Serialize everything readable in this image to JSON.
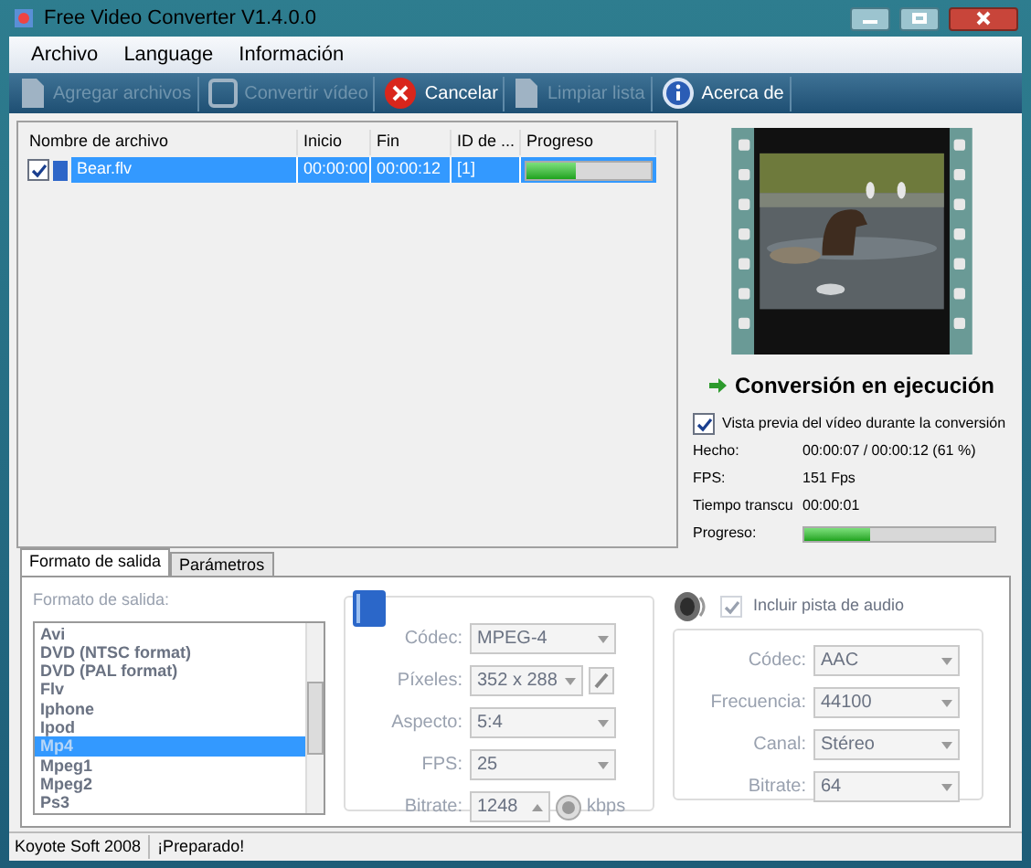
{
  "window": {
    "title": "Free Video Converter V1.4.0.0"
  },
  "menu": [
    "Archivo",
    "Language",
    "Información"
  ],
  "toolbar": [
    {
      "label": "Agregar archivos",
      "kind": "add",
      "disabled": true
    },
    {
      "label": "Convertir vídeo",
      "kind": "convert",
      "disabled": true
    },
    {
      "label": "Cancelar",
      "kind": "cancel",
      "disabled": false
    },
    {
      "label": "Limpiar lista",
      "kind": "clear",
      "disabled": true
    },
    {
      "label": "Acerca de",
      "kind": "about",
      "disabled": false
    }
  ],
  "file_table": {
    "columns": [
      "Nombre de archivo",
      "Inicio",
      "Fin",
      "ID de ...",
      "Progreso"
    ],
    "rows": [
      {
        "checked": true,
        "selected": true,
        "cells": [
          "Bear.flv",
          "00:00:00",
          "00:00:12",
          "[1]"
        ],
        "level": 0.4
      }
    ]
  },
  "preview": {
    "status": "Conversión en ejecución",
    "show_preview": {
      "label": "Vista previa del vídeo durante la conversión",
      "checked": true
    },
    "stats": [
      {
        "label": "Hecho:",
        "value": "00:00:07 / 00:00:12  (61 %)"
      },
      {
        "label": "FPS:",
        "value": "151 Fps"
      },
      {
        "label": "Tiempo transcu",
        "value": "00:00:01"
      }
    ],
    "progress": {
      "label": "Progreso:",
      "level": 0.35
    }
  },
  "tabs": [
    {
      "label": "Formato de salida",
      "selected": true
    },
    {
      "label": "Parámetros",
      "selected": false
    }
  ],
  "output_format": {
    "label": "Formato de salida:",
    "items": [
      {
        "label": "Avi",
        "selected": false
      },
      {
        "label": "DVD (NTSC format)",
        "selected": false
      },
      {
        "label": "DVD (PAL format)",
        "selected": false
      },
      {
        "label": "Flv",
        "selected": false
      },
      {
        "label": "Iphone",
        "selected": false
      },
      {
        "label": "Ipod",
        "selected": false
      },
      {
        "label": "Mp4",
        "selected": true
      },
      {
        "label": "Mpeg1",
        "selected": false
      },
      {
        "label": "Mpeg2",
        "selected": false
      },
      {
        "label": "Ps3",
        "selected": false
      }
    ]
  },
  "video": {
    "fields": [
      {
        "label": "Códec:",
        "value": "MPEG-4",
        "kind": "select"
      },
      {
        "label": "Píxeles:",
        "value": "352 x 288",
        "kind": "select_edit"
      },
      {
        "label": "Aspecto:",
        "value": "5:4",
        "kind": "select"
      },
      {
        "label": "FPS:",
        "value": "25",
        "kind": "select"
      },
      {
        "label": "Bitrate:",
        "value": "1248",
        "kind": "spin",
        "unit": "kbps"
      }
    ]
  },
  "audio": {
    "include": {
      "label": "Incluir pista de audio",
      "checked": true
    },
    "fields": [
      {
        "label": "Códec:",
        "value": "AAC",
        "kind": "select"
      },
      {
        "label": "Frecuencia:",
        "value": "44100",
        "kind": "select"
      },
      {
        "label": "Canal:",
        "value": "Stéreo",
        "kind": "select"
      },
      {
        "label": "Bitrate:",
        "value": "64",
        "kind": "select"
      }
    ]
  },
  "status_bar": [
    "Koyote Soft 2008",
    "¡Preparado!"
  ]
}
